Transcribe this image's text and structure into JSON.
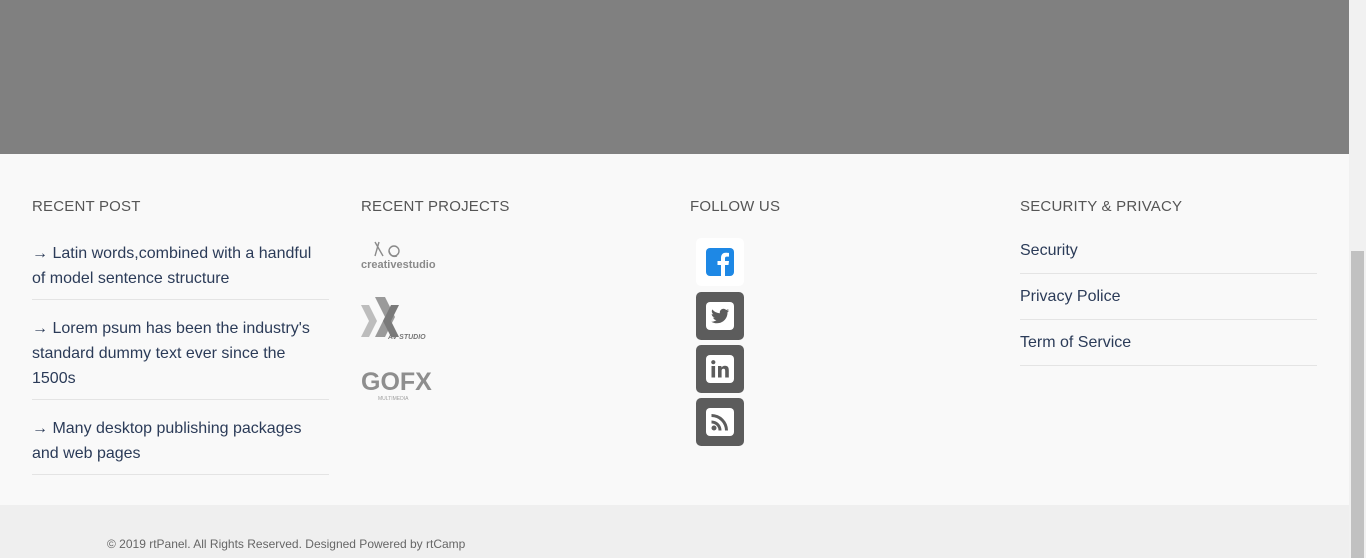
{
  "recent_post": {
    "heading": "RECENT POST",
    "items": [
      {
        "label": "→ Latin words,combined with a handful of model sentence structure"
      },
      {
        "label": "→ Lorem psum has been the industry's standard dummy text ever since the 1500s"
      },
      {
        "label": "→ Many desktop publishing  packages and web pages"
      }
    ]
  },
  "recent_projects": {
    "heading": "RECENT PROJECTS",
    "logos": [
      {
        "text": "creativestudio",
        "icon": "creative-studio-logo"
      },
      {
        "text": "AV STUDIO",
        "icon": "av-studio-logo"
      },
      {
        "text": "GOFX",
        "subtext": "MULTIMEDIA",
        "icon": "gofx-logo"
      }
    ]
  },
  "follow_us": {
    "heading": "FOLLOW US",
    "icons": [
      "facebook-icon",
      "twitter-icon",
      "linkedin-icon",
      "rss-icon"
    ],
    "facebook_color": "#1e88e5",
    "inactive_color": "#5c5c5c"
  },
  "security_privacy": {
    "heading": "SECURITY & PRIVACY",
    "links": [
      {
        "label": "Security"
      },
      {
        "label": "Privacy Police"
      },
      {
        "label": "Term of Service"
      }
    ]
  },
  "footer": {
    "copyright": "© 2019 rtPanel. All Rights Reserved. Designed Powered by rtCamp"
  },
  "colors": {
    "band": "#808080",
    "link": "#2b3b58",
    "heading": "#555555",
    "footer_bg": "#f9f9f9",
    "bottom_bar": "#efefef"
  }
}
